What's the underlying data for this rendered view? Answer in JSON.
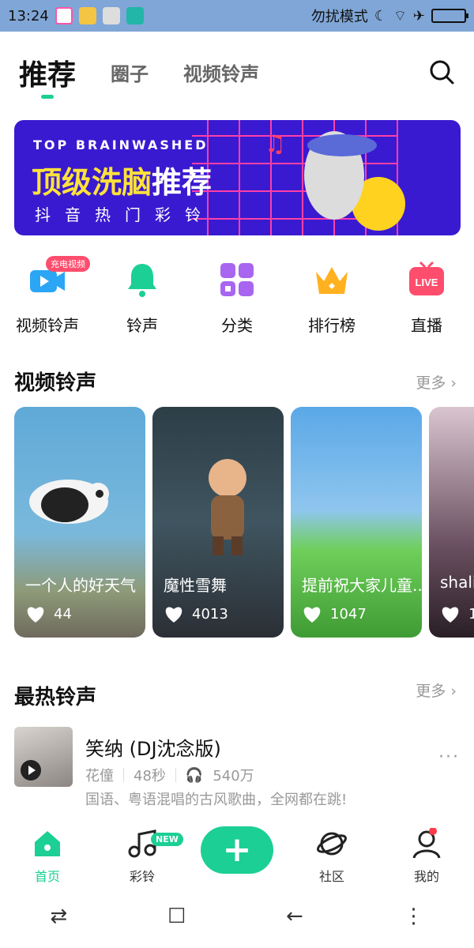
{
  "status": {
    "time": "13:24",
    "dnd_text": "勿扰模式"
  },
  "nav": {
    "tabs": [
      {
        "label": "推荐"
      },
      {
        "label": "圈子"
      },
      {
        "label": "视频铃声"
      }
    ]
  },
  "banner": {
    "en_title": "TOP BRAINWASHED",
    "cn_title_1": "顶级洗脑",
    "cn_title_2": "推荐",
    "subtitle": "抖音热门彩铃"
  },
  "categories": [
    {
      "label": "视频铃声",
      "badge": "充电视频",
      "icon": "video-icon"
    },
    {
      "label": "铃声",
      "icon": "bell-icon"
    },
    {
      "label": "分类",
      "icon": "grid-icon"
    },
    {
      "label": "排行榜",
      "icon": "crown-icon"
    },
    {
      "label": "直播",
      "icon": "live-icon",
      "icon_text": "LIVE"
    }
  ],
  "section_video": {
    "title": "视频铃声",
    "more": "更多 ›"
  },
  "video_cards": [
    {
      "title": "一个人的好天气",
      "likes": "44"
    },
    {
      "title": "魔性雪舞",
      "likes": "4013"
    },
    {
      "title": "提前祝大家儿童...",
      "likes": "1047"
    },
    {
      "title": "shali",
      "likes": "1"
    }
  ],
  "section_hot": {
    "title": "最热铃声",
    "more": "更多 ›"
  },
  "song": {
    "name": "笑纳 (DJ沈念版)",
    "artist": "花僮",
    "duration": "48秒",
    "plays": "540万",
    "description": "国语、粤语混唱的古风歌曲，全网都在跳!"
  },
  "tabbar": {
    "items": [
      {
        "label": "首页",
        "icon": "home-icon"
      },
      {
        "label": "彩铃",
        "icon": "music-note-icon",
        "badge": "NEW"
      },
      {
        "label": "",
        "icon": "plus-icon"
      },
      {
        "label": "社区",
        "icon": "planet-icon"
      },
      {
        "label": "我的",
        "icon": "profile-icon"
      }
    ]
  },
  "colors": {
    "accent": "#1ccf95",
    "banner_bg": "#3a1ad0",
    "banner_title": "#ffe23a"
  }
}
